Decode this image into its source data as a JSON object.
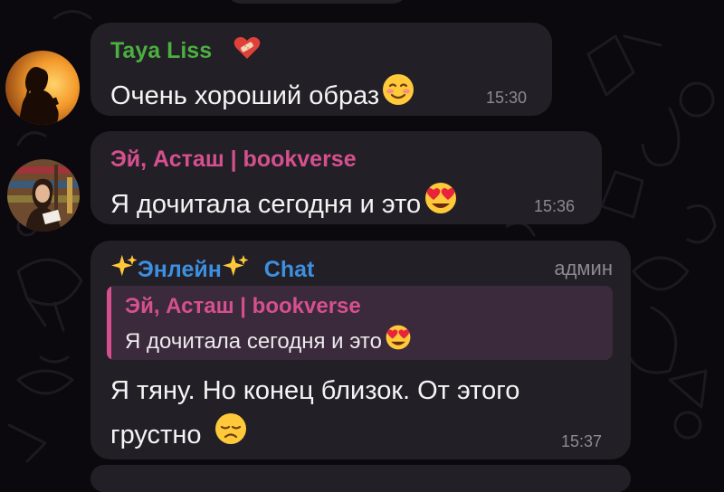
{
  "colors": {
    "background": "#0b090d",
    "bubble": "#221f26",
    "sender_taya": "#4caf3f",
    "sender_ei": "#d6508f",
    "sender_enlein": "#3d8fe0",
    "meta_gray": "#8e8a94",
    "reply_bg": "#3a2a3b"
  },
  "messages": [
    {
      "sender": "Taya Liss",
      "sender_status_icon": "mended-heart-icon",
      "text": "Очень хороший образ",
      "text_emoji": "smiling-blush-emoji",
      "time": "15:30",
      "avatar": "silhouette-sunset-avatar"
    },
    {
      "sender": "Эй, Асташ | bookverse",
      "text": "Я дочитала сегодня и это",
      "text_emoji": "heart-eyes-emoji",
      "time": "15:36",
      "avatar": "girl-library-avatar"
    },
    {
      "sender_name": "Энлейн",
      "sender_emoji_left": "sparkles-emoji",
      "sender_emoji_right": "sparkles-emoji",
      "sender_suffix": "Chat",
      "role": "админ",
      "reply": {
        "sender": "Эй, Асташ | bookverse",
        "text": "Я дочитала сегодня и это",
        "text_emoji": "heart-eyes-emoji"
      },
      "text_line1": "Я тяну. Но конец близок. От этого",
      "text_line2": "грустно",
      "text_emoji": "disappointed-face-emoji",
      "time": "15:37"
    }
  ]
}
